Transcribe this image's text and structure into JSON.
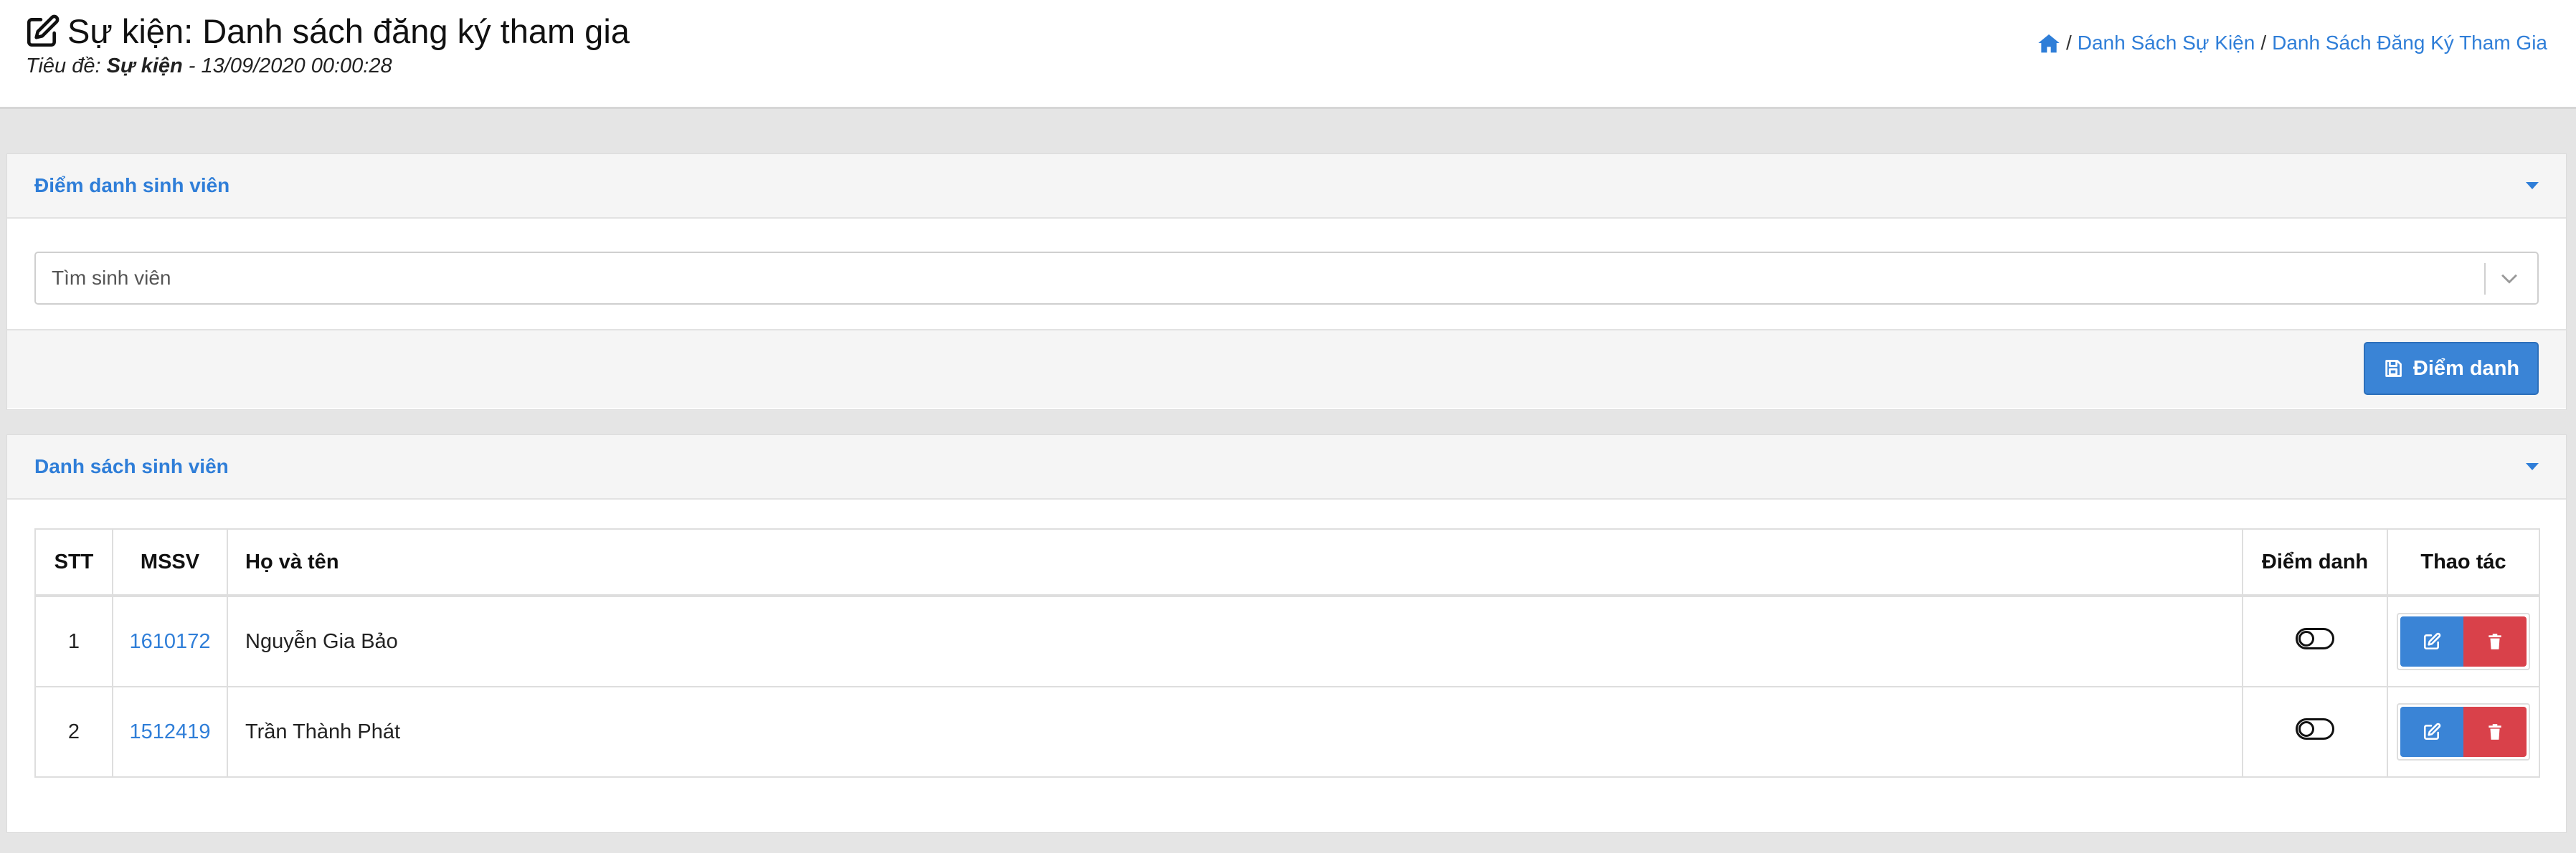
{
  "header": {
    "title": "Sự kiện: Danh sách đăng ký tham gia",
    "subtitle_prefix": "Tiêu đề: ",
    "subtitle_event": "Sự kiện",
    "subtitle_suffix": " - 13/09/2020 00:00:28",
    "title_icon": "edit-icon"
  },
  "breadcrumb": {
    "home_icon": "home-icon",
    "separator": "/",
    "items": [
      "Danh Sách Sự Kiện",
      "Danh Sách Đăng Ký Tham Gia"
    ]
  },
  "attendance_panel": {
    "title": "Điểm danh sinh viên",
    "search_placeholder": "Tìm sinh viên",
    "submit_label": "Điểm danh",
    "submit_icon": "save-icon"
  },
  "student_panel": {
    "title": "Danh sách sinh viên",
    "columns": [
      "STT",
      "MSSV",
      "Họ và tên",
      "Điểm danh",
      "Thao tác"
    ],
    "rows": [
      {
        "stt": "1",
        "mssv": "1610172",
        "name": "Nguyễn Gia Bảo",
        "attended": false
      },
      {
        "stt": "2",
        "mssv": "1512419",
        "name": "Trần Thành Phát",
        "attended": false
      }
    ]
  },
  "colors": {
    "accent": "#2f7ed8",
    "primary_button": "#3a84d6",
    "danger_button": "#d9414a",
    "page_background": "#e5e5e5"
  }
}
